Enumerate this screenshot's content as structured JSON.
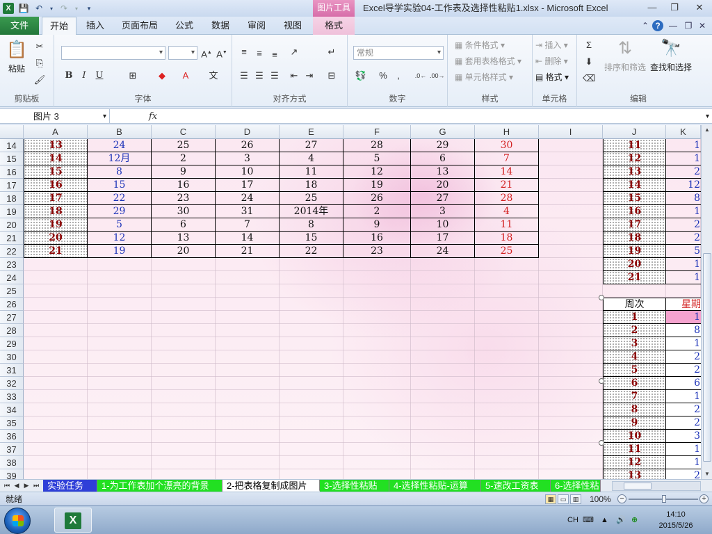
{
  "titlebar": {
    "app_icon": "X",
    "picture_tools": "图片工具",
    "title": "Excel导学实验04-工作表及选择性粘贴1.xlsx  -  Microsoft Excel",
    "save_icon": "save-icon",
    "undo_icon": "undo-icon",
    "redo_icon": "redo-icon"
  },
  "tabs": {
    "file": "文件",
    "home": "开始",
    "insert": "插入",
    "page_layout": "页面布局",
    "formulas": "公式",
    "data": "数据",
    "review": "审阅",
    "view": "视图",
    "format": "格式"
  },
  "ribbon": {
    "clipboard": {
      "label": "剪贴板",
      "paste": "粘贴"
    },
    "font": {
      "label": "字体",
      "bold": "B",
      "italic": "I",
      "underline": "U"
    },
    "alignment": {
      "label": "对齐方式"
    },
    "number": {
      "label": "数字",
      "format": "常规",
      "percent": "%",
      "comma": ","
    },
    "styles": {
      "label": "样式",
      "conditional": "条件格式",
      "table": "套用表格格式",
      "cell": "单元格样式"
    },
    "cells": {
      "label": "单元格",
      "insert": "插入",
      "delete": "删除",
      "format": "格式"
    },
    "editing": {
      "label": "编辑",
      "sort_filter": "排序和筛选",
      "find_select": "查找和选择"
    }
  },
  "formula_bar": {
    "name_box": "图片 3",
    "fx": "fx"
  },
  "columns": [
    "A",
    "B",
    "C",
    "D",
    "E",
    "F",
    "G",
    "H",
    "I",
    "J",
    "K"
  ],
  "rows": [
    "14",
    "15",
    "16",
    "17",
    "18",
    "19",
    "20",
    "21",
    "22",
    "23",
    "24",
    "25",
    "26",
    "27",
    "28",
    "29",
    "30",
    "31",
    "32",
    "33",
    "34",
    "35",
    "36",
    "37",
    "38",
    "39"
  ],
  "calendar_table": [
    [
      "13",
      "24",
      "25",
      "26",
      "27",
      "28",
      "29",
      "30"
    ],
    [
      "14",
      "12月",
      "2",
      "3",
      "4",
      "5",
      "6",
      "7"
    ],
    [
      "15",
      "8",
      "9",
      "10",
      "11",
      "12",
      "13",
      "14"
    ],
    [
      "16",
      "15",
      "16",
      "17",
      "18",
      "19",
      "20",
      "21"
    ],
    [
      "17",
      "22",
      "23",
      "24",
      "25",
      "26",
      "27",
      "28"
    ],
    [
      "18",
      "29",
      "30",
      "31",
      "2014年",
      "2",
      "3",
      "4"
    ],
    [
      "19",
      "5",
      "6",
      "7",
      "8",
      "9",
      "10",
      "11"
    ],
    [
      "20",
      "12",
      "13",
      "14",
      "15",
      "16",
      "17",
      "18"
    ],
    [
      "21",
      "19",
      "20",
      "21",
      "22",
      "23",
      "24",
      "25"
    ]
  ],
  "right_table_top": [
    [
      "11",
      "1"
    ],
    [
      "12",
      "1"
    ],
    [
      "13",
      "2"
    ],
    [
      "14",
      "12"
    ],
    [
      "15",
      "8"
    ],
    [
      "16",
      "1"
    ],
    [
      "17",
      "2"
    ],
    [
      "18",
      "2"
    ],
    [
      "19",
      "5"
    ],
    [
      "20",
      "1"
    ],
    [
      "21",
      "1"
    ]
  ],
  "picture_table": {
    "header": [
      "周次",
      "星期"
    ],
    "rows": [
      [
        "1",
        "1"
      ],
      [
        "2",
        "8"
      ],
      [
        "3",
        "1"
      ],
      [
        "4",
        "2"
      ],
      [
        "5",
        "2"
      ],
      [
        "6",
        "6"
      ],
      [
        "7",
        "1"
      ],
      [
        "8",
        "2"
      ],
      [
        "9",
        "2"
      ],
      [
        "10",
        "3"
      ],
      [
        "11",
        "1"
      ],
      [
        "12",
        "1"
      ],
      [
        "13",
        "2"
      ]
    ]
  },
  "sheet_tabs": [
    {
      "label": "实验任务",
      "style": "blue"
    },
    {
      "label": "1-为工作表加个漂亮的背景",
      "style": "green"
    },
    {
      "label": "2-把表格复制成图片",
      "style": "active"
    },
    {
      "label": "3-选择性粘贴",
      "style": "green"
    },
    {
      "label": "4-选择性粘贴-运算",
      "style": "green"
    },
    {
      "label": "5-速改工资表",
      "style": "green"
    },
    {
      "label": "6-选择性粘",
      "style": "green"
    }
  ],
  "status": {
    "text": "就绪",
    "zoom": "100%"
  },
  "taskbar": {
    "ime": "CH",
    "time": "14:10",
    "date": "2015/5/26"
  },
  "colors": {
    "file_tab": "#23773a",
    "picture_tools": "#d76ea9",
    "tab_green": "#22e022",
    "tab_blue": "#2f3fd8",
    "week_number": "#8b0000",
    "weekend": "#d21f1f",
    "date_blue": "#1d33b8"
  }
}
